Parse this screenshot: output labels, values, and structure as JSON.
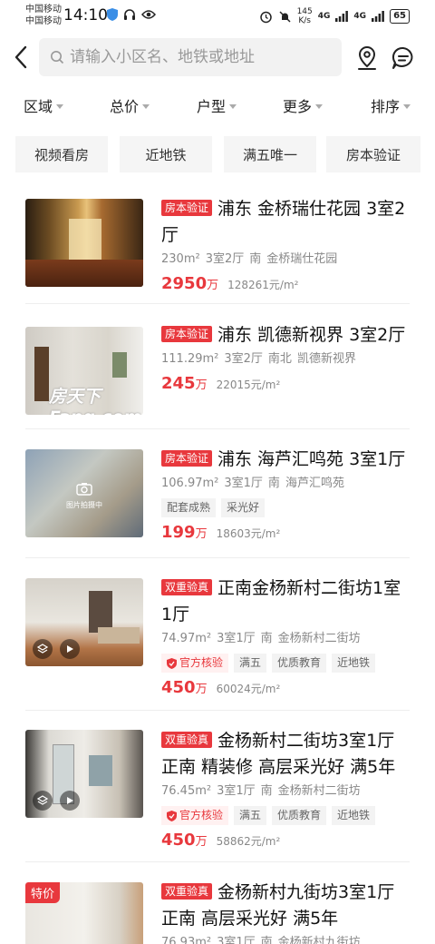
{
  "status": {
    "carrier1": "中国移动",
    "carrier2": "中国移动",
    "time": "14:10",
    "netspeed_top": "145",
    "netspeed_unit": "K/s",
    "sig1": "4G",
    "sig2": "4G",
    "battery": "65"
  },
  "search": {
    "placeholder": "请输入小区名、地铁或地址"
  },
  "filters": [
    "区域",
    "总价",
    "户型",
    "更多",
    "排序"
  ],
  "tags": [
    "视频看房",
    "近地铁",
    "满五唯一",
    "房本验证"
  ],
  "listings": [
    {
      "badge": "房本验证",
      "title": "浦东 金桥瑞仕花园 3室2厅",
      "area": "230m²",
      "layout": "3室2厅",
      "orientation": "南",
      "community": "金桥瑞仕花园",
      "price": "2950",
      "price_unit": "万",
      "unit_price": "128261元/m²"
    },
    {
      "badge": "房本验证",
      "title": "浦东 凯德新视界 3室2厅",
      "area": "111.29m²",
      "layout": "3室2厅",
      "orientation": "南北",
      "community": "凯德新视界",
      "price": "245",
      "price_unit": "万",
      "unit_price": "22015元/m²",
      "watermark": "房天下 Fang.com"
    },
    {
      "badge": "房本验证",
      "title": "浦东 海芦汇鸣苑 3室1厅",
      "area": "106.97m²",
      "layout": "3室1厅",
      "orientation": "南",
      "community": "海芦汇鸣苑",
      "chips": [
        "配套成熟",
        "采光好"
      ],
      "price": "199",
      "price_unit": "万",
      "unit_price": "18603元/m²",
      "thumb_caption": "图片拍摄中"
    },
    {
      "badge": "双重验真",
      "title": "正南金杨新村二街坊1室1厅",
      "area": "74.97m²",
      "layout": "3室1厅",
      "orientation": "南",
      "community": "金杨新村二街坊",
      "official": "官方核验",
      "chips": [
        "满五",
        "优质教育",
        "近地铁"
      ],
      "price": "450",
      "price_unit": "万",
      "unit_price": "60024元/m²"
    },
    {
      "badge": "双重验真",
      "title": "金杨新村二街坊3室1厅 正南 精装修 高层采光好 满5年",
      "area": "76.45m²",
      "layout": "3室1厅",
      "orientation": "南",
      "community": "金杨新村二街坊",
      "official": "官方核验",
      "chips": [
        "满五",
        "优质教育",
        "近地铁"
      ],
      "price": "450",
      "price_unit": "万",
      "unit_price": "58862元/m²"
    },
    {
      "badge": "双重验真",
      "sale_tag": "特价",
      "title": "金杨新村九街坊3室1厅 正南 高层采光好 满5年",
      "area": "76.93m²",
      "layout": "3室1厅",
      "orientation": "南",
      "community": "金杨新村九街坊"
    }
  ],
  "colors": {
    "accent": "#e8383d"
  }
}
